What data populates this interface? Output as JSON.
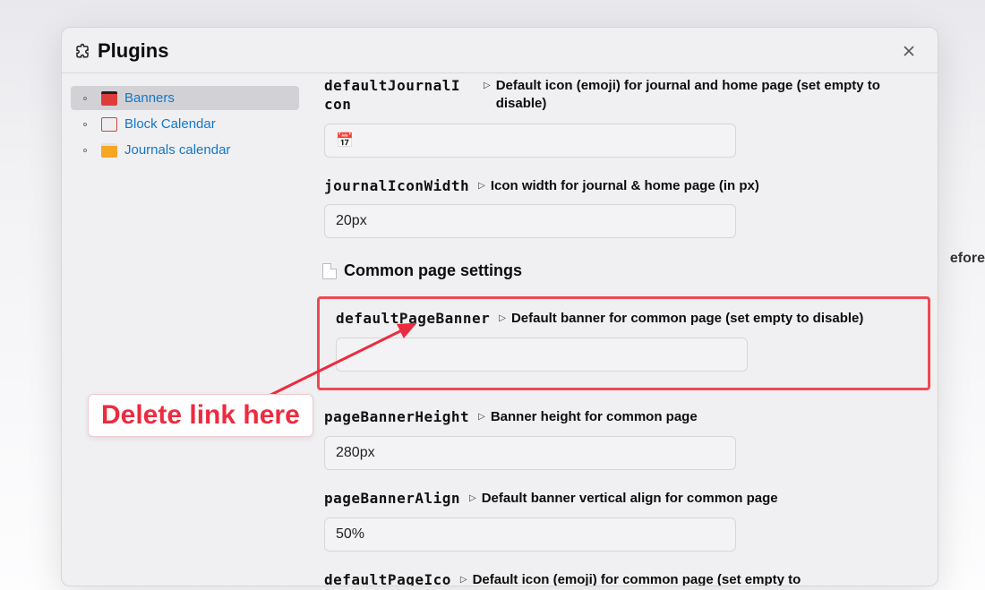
{
  "backdrop": {
    "hint_right": "efore"
  },
  "modal": {
    "title": "Plugins"
  },
  "sidebar": {
    "items": [
      {
        "label": "Banners"
      },
      {
        "label": "Block Calendar"
      },
      {
        "label": "Journals calendar"
      }
    ]
  },
  "section": {
    "common_heading": "Common page settings"
  },
  "settings": {
    "defaultJournalIcon": {
      "key": "defaultJournalI\ncon",
      "desc": "Default icon (emoji) for journal and home page (set empty to disable)",
      "value": "📅"
    },
    "journalIconWidth": {
      "key": "journalIconWidth",
      "desc": "Icon width for journal & home page (in px)",
      "value": "20px"
    },
    "defaultPageBanner": {
      "key": "defaultPageBanner",
      "desc": "Default banner for common page (set empty to disable)",
      "value": ""
    },
    "pageBannerHeight": {
      "key": "pageBannerHeight",
      "desc": "Banner height for common page",
      "value": "280px"
    },
    "pageBannerAlign": {
      "key": "pageBannerAlign",
      "desc": "Default banner vertical align for common page",
      "value": "50%"
    },
    "defaultPageIco": {
      "key": "defaultPageIco",
      "desc": "Default icon (emoji) for common page (set empty to"
    }
  },
  "annotation": {
    "label": "Delete link here"
  }
}
